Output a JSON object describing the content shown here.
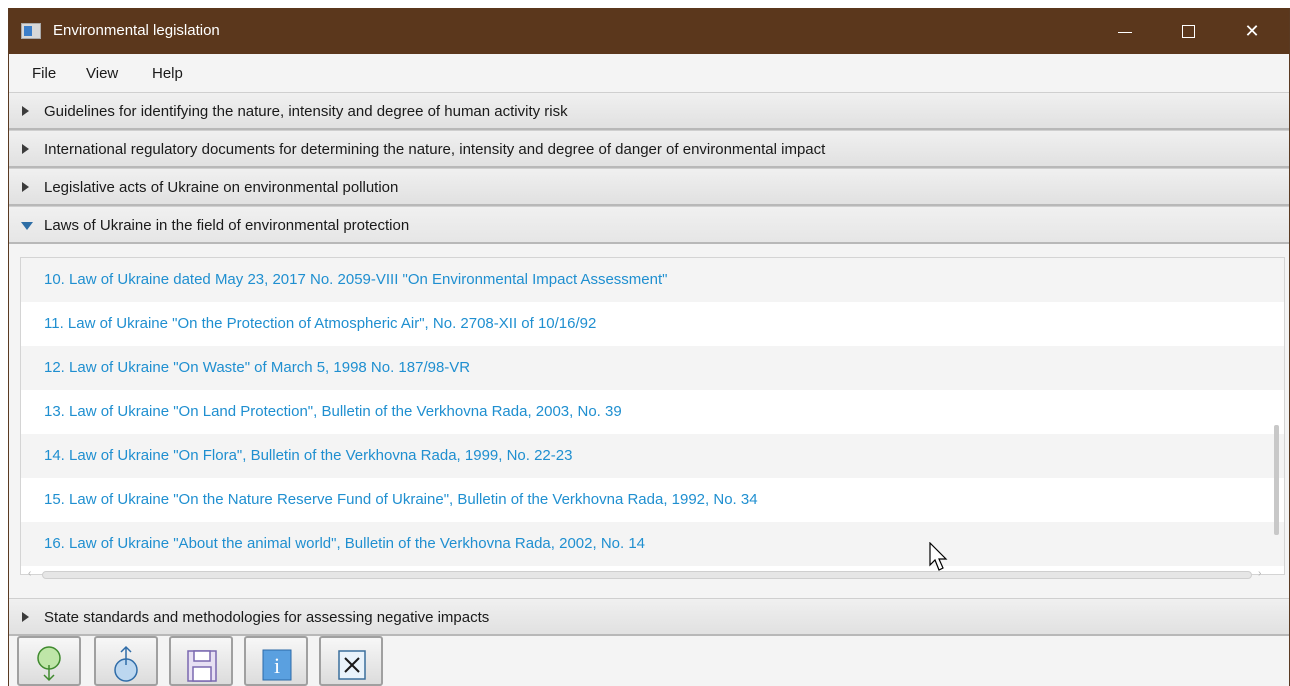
{
  "window": {
    "title": "Environmental legislation",
    "controls": {
      "minimize": "minimize",
      "maximize": "maximize",
      "close": "✕"
    }
  },
  "menu": {
    "file": "File",
    "view": "View",
    "help": "Help"
  },
  "panes": [
    {
      "label": "Guidelines for identifying the nature, intensity and degree of human activity risk",
      "expanded": false
    },
    {
      "label": "International regulatory documents for determining the nature, intensity and degree of danger of environmental impact",
      "expanded": false
    },
    {
      "label": "Legislative acts of Ukraine on environmental pollution",
      "expanded": false
    },
    {
      "label": "Laws of Ukraine in the field of environmental protection",
      "expanded": true
    },
    {
      "label": "State standards and methodologies for assessing negative impacts",
      "expanded": false
    }
  ],
  "laws": [
    "10. Law of Ukraine dated May 23, 2017 No. 2059-VIII \"On Environmental Impact Assessment\"",
    "11. Law of Ukraine \"On the Protection of Atmospheric Air\", No. 2708-XII of 10/16/92",
    "12. Law of Ukraine \"On Waste\" of March 5, 1998 No. 187/98-VR",
    "13. Law of Ukraine \"On Land Protection\", Bulletin of the Verkhovna Rada, 2003, No. 39",
    "14. Law of Ukraine \"On Flora\", Bulletin of the Verkhovna Rada, 1999, No. 22-23",
    "15. Law of Ukraine \"On the Nature Reserve Fund of Ukraine\", Bulletin of the Verkhovna Rada, 1992, No. 34",
    "16. Law of Ukraine \"About the animal world\", Bulletin of the Verkhovna Rada, 2002, No. 14"
  ],
  "toolbar": {
    "buttons": [
      "download-icon",
      "upload-icon",
      "save-icon",
      "info-icon",
      "close-icon"
    ],
    "info_glyph": "i"
  },
  "colors": {
    "titlebar": "#5b371c",
    "link": "#1f8fd0",
    "expanded_arrow": "#2e6ea6"
  }
}
